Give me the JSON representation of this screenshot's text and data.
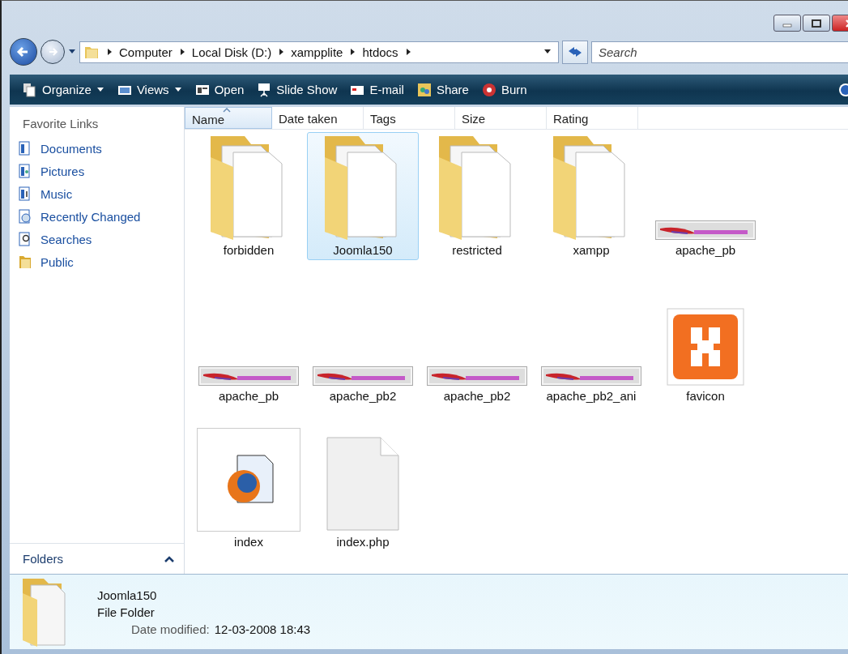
{
  "address_bar": {
    "path": [
      "Computer",
      "Local Disk (D:)",
      "xampplite",
      "htdocs"
    ]
  },
  "search": {
    "placeholder": "Search"
  },
  "toolbar": [
    {
      "label": "Organize",
      "kind": "organize",
      "dropdown": true
    },
    {
      "label": "Views",
      "kind": "views",
      "dropdown": true
    },
    {
      "label": "Open",
      "kind": "open",
      "dropdown": false
    },
    {
      "label": "Slide Show",
      "kind": "slideshow",
      "dropdown": false
    },
    {
      "label": "E-mail",
      "kind": "email",
      "dropdown": false
    },
    {
      "label": "Share",
      "kind": "share",
      "dropdown": false
    },
    {
      "label": "Burn",
      "kind": "burn",
      "dropdown": false
    }
  ],
  "sidebar": {
    "title": "Favorite Links",
    "items": [
      {
        "label": "Documents",
        "kind": "documents"
      },
      {
        "label": "Pictures",
        "kind": "pictures"
      },
      {
        "label": "Music",
        "kind": "music"
      },
      {
        "label": "Recently Changed",
        "kind": "recent"
      },
      {
        "label": "Searches",
        "kind": "searches"
      },
      {
        "label": "Public",
        "kind": "folder"
      }
    ],
    "folders_label": "Folders"
  },
  "columns": [
    {
      "label": "Name",
      "sorted": true
    },
    {
      "label": "Date taken",
      "sorted": false
    },
    {
      "label": "Tags",
      "sorted": false
    },
    {
      "label": "Size",
      "sorted": false
    },
    {
      "label": "Rating",
      "sorted": false
    }
  ],
  "items": [
    {
      "name": "forbidden",
      "kind": "folder",
      "selected": false
    },
    {
      "name": "Joomla150",
      "kind": "folder",
      "selected": true
    },
    {
      "name": "restricted",
      "kind": "folder",
      "selected": false
    },
    {
      "name": "xampp",
      "kind": "folder",
      "selected": false
    },
    {
      "name": "apache_pb",
      "kind": "banner",
      "selected": false
    },
    {
      "name": "apache_pb",
      "kind": "banner",
      "selected": false
    },
    {
      "name": "apache_pb2",
      "kind": "banner",
      "selected": false
    },
    {
      "name": "apache_pb2",
      "kind": "banner",
      "selected": false
    },
    {
      "name": "apache_pb2_ani",
      "kind": "banner",
      "selected": false
    },
    {
      "name": "favicon",
      "kind": "favicon",
      "selected": false
    },
    {
      "name": "index",
      "kind": "html",
      "selected": false
    },
    {
      "name": "index.php",
      "kind": "file",
      "selected": false
    }
  ],
  "details": {
    "name": "Joomla150",
    "type": "File Folder",
    "date_label": "Date modified:",
    "date_value": "12-03-2008 18:43"
  }
}
